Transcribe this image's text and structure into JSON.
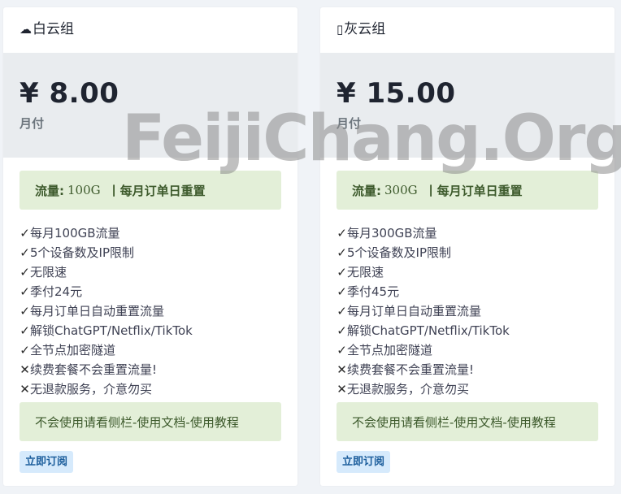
{
  "plans": [
    {
      "icon": "cloud-icon",
      "icon_glyph": "☁",
      "name": "白云组",
      "price": "¥ 8.00",
      "period": "月付",
      "traffic_label": "流量:",
      "traffic_value": "100G",
      "reset_note": "丨每月订单日重置",
      "features": [
        {
          "mark": "✓",
          "text": "每月100GB流量"
        },
        {
          "mark": "✓",
          "text": "5个设备数及IP限制"
        },
        {
          "mark": "✓",
          "text": "无限速"
        },
        {
          "mark": "✓",
          "text": "季付24元"
        },
        {
          "mark": "✓",
          "text": "每月订单日自动重置流量"
        },
        {
          "mark": "✓",
          "text": "解锁ChatGPT/Netflix/TikTok"
        },
        {
          "mark": "✓",
          "text": "全节点加密隧道"
        },
        {
          "mark": "✕",
          "text": "续费套餐不会重置流量!"
        },
        {
          "mark": "✕",
          "text": "无退款服务，介意勿买"
        }
      ],
      "note": "不会使用请看侧栏-使用文档-使用教程",
      "button": "立即订阅"
    },
    {
      "icon": "missing-glyph-icon",
      "icon_glyph": "▯",
      "name": "灰云组",
      "price": "¥ 15.00",
      "period": "月付",
      "traffic_label": "流量:",
      "traffic_value": "300G",
      "reset_note": "丨每月订单日重置",
      "features": [
        {
          "mark": "✓",
          "text": "每月300GB流量"
        },
        {
          "mark": "✓",
          "text": "5个设备数及IP限制"
        },
        {
          "mark": "✓",
          "text": "无限速"
        },
        {
          "mark": "✓",
          "text": "季付45元"
        },
        {
          "mark": "✓",
          "text": "每月订单日自动重置流量"
        },
        {
          "mark": "✓",
          "text": "解锁ChatGPT/Netflix/TikTok"
        },
        {
          "mark": "✓",
          "text": "全节点加密隧道"
        },
        {
          "mark": "✕",
          "text": "续费套餐不会重置流量!"
        },
        {
          "mark": "✕",
          "text": "无退款服务，介意勿买"
        }
      ],
      "note": "不会使用请看侧栏-使用文档-使用教程",
      "button": "立即订阅"
    }
  ],
  "watermark": "FeijiChang.Org",
  "colors": {
    "page_bg": "#f0f3f7",
    "price_band": "#e9ecef",
    "alert_bg": "#e3efd8",
    "alert_text": "#3d5a2c",
    "button_bg": "#d6eafc",
    "button_text": "#1c5e9c"
  }
}
